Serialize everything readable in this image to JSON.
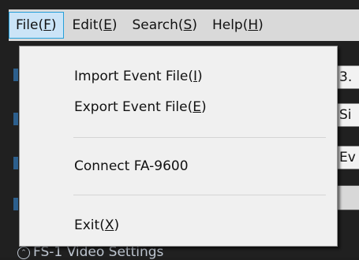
{
  "menubar": {
    "items": [
      {
        "label": "File(",
        "mnemonic": "F",
        "suffix": ")"
      },
      {
        "label": "Edit(",
        "mnemonic": "E",
        "suffix": ")"
      },
      {
        "label": "Search(",
        "mnemonic": "S",
        "suffix": ")"
      },
      {
        "label": "Help(",
        "mnemonic": "H",
        "suffix": ")"
      }
    ]
  },
  "file_menu": {
    "items": [
      {
        "label": "Import Event File(",
        "mnemonic": "I",
        "suffix": ")"
      },
      {
        "label": "Export Event File(",
        "mnemonic": "E",
        "suffix": ")"
      },
      {
        "label": "Connect FA-9600",
        "mnemonic": "",
        "suffix": ""
      },
      {
        "label": "Exit(",
        "mnemonic": "X",
        "suffix": ")"
      }
    ]
  },
  "background": {
    "field1": "3.",
    "field2": "Si",
    "field3": "Ev",
    "bottom_text": "FS-1 Video Settings",
    "bottom_icon": "collapse-icon"
  },
  "colors": {
    "menubar_bg": "#d9d9d9",
    "active_highlight": "#cbe4f7",
    "active_border": "#26a0da",
    "menu_bg": "#f0f0f0"
  }
}
